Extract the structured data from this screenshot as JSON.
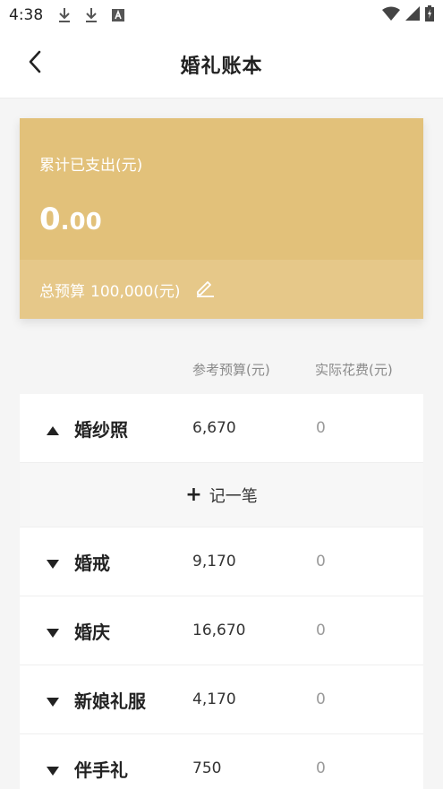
{
  "status_bar": {
    "time": "4:38",
    "icons": [
      "download-icon",
      "download-icon",
      "text-a-icon",
      "wifi-icon",
      "signal-icon",
      "battery-charging-icon"
    ]
  },
  "header": {
    "title": "婚礼账本",
    "back_icon": "chevron-left-icon"
  },
  "summary": {
    "spent_label": "累计已支出(元)",
    "spent_int": "0",
    "spent_dec": ".00",
    "budget_label": "总预算",
    "budget_value": "100,000(元)",
    "edit_icon": "pencil-icon",
    "color": "#e2c17a"
  },
  "columns": {
    "reference": "参考预算(元)",
    "actual": "实际花费(元)"
  },
  "add_record": {
    "plus": "+",
    "label": "记一笔"
  },
  "categories": [
    {
      "name": "婚纱照",
      "budget": "6,670",
      "actual": "0",
      "expanded": true
    },
    {
      "name": "婚戒",
      "budget": "9,170",
      "actual": "0",
      "expanded": false
    },
    {
      "name": "婚庆",
      "budget": "16,670",
      "actual": "0",
      "expanded": false
    },
    {
      "name": "新娘礼服",
      "budget": "4,170",
      "actual": "0",
      "expanded": false
    },
    {
      "name": "伴手礼",
      "budget": "750",
      "actual": "0",
      "expanded": false
    }
  ]
}
